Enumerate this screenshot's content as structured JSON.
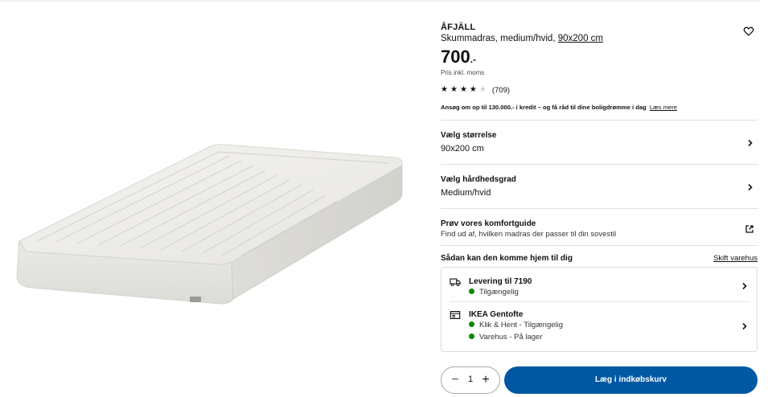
{
  "product": {
    "name": "ÅFJÄLL",
    "description": "Skummadras, medium/hvid,",
    "size_link": "90x200 cm",
    "price": "700",
    "price_suffix": ".-",
    "vat_note": "Pris inkl. moms",
    "rating": 3.5,
    "rating_max": 5,
    "review_count": "(709)",
    "credit_text": "Ansøg om op til 130.000.- i kredit – og få råd til dine boligdrømme i dag",
    "credit_link": "Læs mere",
    "favorite_icon": "heart-icon"
  },
  "options": {
    "size": {
      "title": "Vælg størrelse",
      "value": "90x200 cm"
    },
    "firmness": {
      "title": "Vælg hårdhedsgrad",
      "value": "Medium/hvid"
    },
    "comfort": {
      "title": "Prøv vores komfortguide",
      "subtitle": "Find ud af, hvilken madras der passer til din sovestil"
    }
  },
  "delivery": {
    "heading": "Sådan kan den komme hjem til dig",
    "change_store": "Skift varehus",
    "home_delivery": {
      "title": "Levering til 7190",
      "status": "Tilgængelig",
      "icon": "truck-icon"
    },
    "store": {
      "title": "IKEA Gentofte",
      "status_pickup": "Klik & Hent - Tilgængelig",
      "status_stock": "Varehus - På lager",
      "icon": "store-icon"
    },
    "status_color": "#0a8a00"
  },
  "cart": {
    "quantity": "1",
    "minus": "−",
    "plus": "+",
    "add_label": "Læg i indkøbskurv",
    "button_color": "#0058a3"
  }
}
